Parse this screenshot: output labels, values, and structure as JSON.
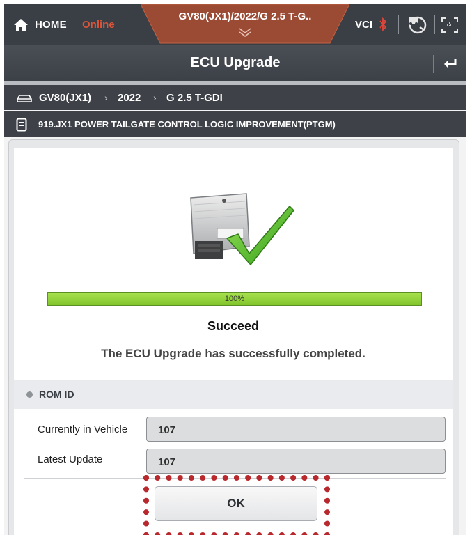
{
  "topbar": {
    "home_label": "HOME",
    "online_label": "Online",
    "vehicle_tab": "GV80(JX1)/2022/G 2.5 T-G..",
    "vci_label": "VCI",
    "accent_color": "#d9553a"
  },
  "titlebar": {
    "title": "ECU Upgrade"
  },
  "breadcrumb": {
    "model": "GV80(JX1)",
    "year": "2022",
    "engine": "G 2.5 T-GDI"
  },
  "info": {
    "text": "919.JX1 POWER TAILGATE CONTROL LOGIC IMPROVEMENT(PTGM)"
  },
  "progress": {
    "value": 1.0,
    "label": "100%",
    "color": "#8fd13b"
  },
  "result": {
    "status": "Succeed",
    "message": "The ECU Upgrade has successfully completed."
  },
  "rom": {
    "header": "ROM ID",
    "rows": [
      {
        "label": "Currently in Vehicle",
        "value": "107"
      },
      {
        "label": "Latest Update",
        "value": "107"
      }
    ]
  },
  "ok_button": {
    "label": "OK"
  },
  "icons": [
    "home-icon",
    "chevron-down-icon",
    "bluetooth-icon",
    "car-connect-icon",
    "screen-capture-icon",
    "back-icon",
    "car-icon",
    "document-icon",
    "ecu-success-icon"
  ],
  "highlight_color": "#b8282c"
}
